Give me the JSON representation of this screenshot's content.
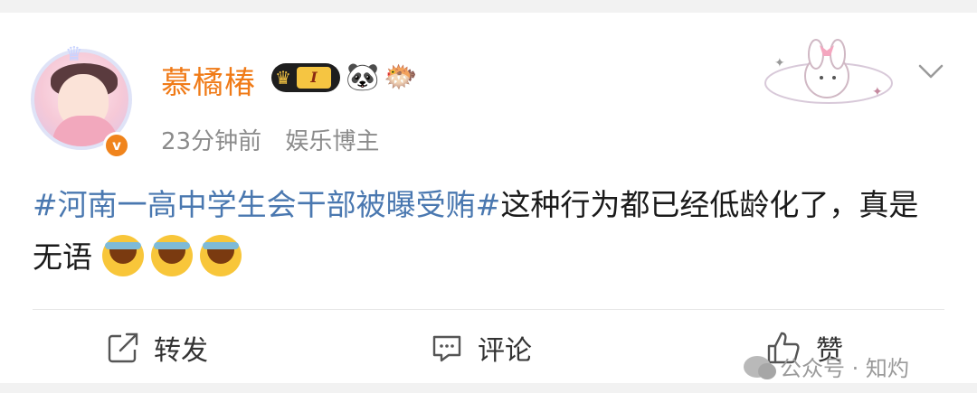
{
  "post": {
    "author": "慕橘椿",
    "level_badge": "I",
    "time": "23分钟前",
    "tag": "娱乐博主",
    "topic": "#河南一高中学生会干部被曝受贿#",
    "text": "这种行为都已经低龄化了，真是无语",
    "verified_mark": "v"
  },
  "actions": {
    "repost": "转发",
    "comment": "评论",
    "like": "赞"
  },
  "watermark": {
    "text": "公众号 · 知灼"
  },
  "icons": [
    "avatar",
    "verified-badge-icon",
    "crown-level-icon",
    "panda-icon",
    "fish-icon",
    "bunny-decoration-icon",
    "chevron-down-icon",
    "crying-laugh-emoji",
    "repost-icon",
    "comment-icon",
    "like-icon",
    "wechat-icon"
  ],
  "colors": {
    "author": "#f07b18",
    "topic": "#4a78b0",
    "meta": "#8b8b8b",
    "verified": "#f0841c"
  }
}
